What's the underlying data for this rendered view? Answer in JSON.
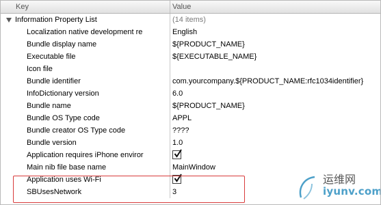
{
  "header": {
    "key_label": "Key",
    "value_label": "Value"
  },
  "rows": [
    {
      "key": "Information Property List",
      "value": "(14 items)"
    },
    {
      "key": "Localization native development re",
      "value": "English"
    },
    {
      "key": "Bundle display name",
      "value": "${PRODUCT_NAME}"
    },
    {
      "key": "Executable file",
      "value": "${EXECUTABLE_NAME}"
    },
    {
      "key": "Icon file",
      "value": ""
    },
    {
      "key": "Bundle identifier",
      "value": "com.yourcompany.${PRODUCT_NAME:rfc1034identifier}"
    },
    {
      "key": "InfoDictionary version",
      "value": "6.0"
    },
    {
      "key": "Bundle name",
      "value": "${PRODUCT_NAME}"
    },
    {
      "key": "Bundle OS Type code",
      "value": "APPL"
    },
    {
      "key": "Bundle creator OS Type code",
      "value": "????"
    },
    {
      "key": "Bundle version",
      "value": "1.0"
    },
    {
      "key": "Application requires iPhone enviror",
      "value": "",
      "checked": true
    },
    {
      "key": "Main nib file base name",
      "value": "MainWindow"
    },
    {
      "key": "Application uses Wi-Fi",
      "value": "",
      "checked": true
    },
    {
      "key": "SBUsesNetwork",
      "value": "3"
    }
  ],
  "watermark": {
    "line1": "运维网",
    "line2": "iyunv.com"
  },
  "colors": {
    "highlight": "#d83a3a",
    "header_bg": "#e8e8e8",
    "watermark_blue": "#4da0c9"
  },
  "icons": {
    "disclosure": "disclosure-triangle-icon",
    "checkbox": "checkbox-icon"
  }
}
